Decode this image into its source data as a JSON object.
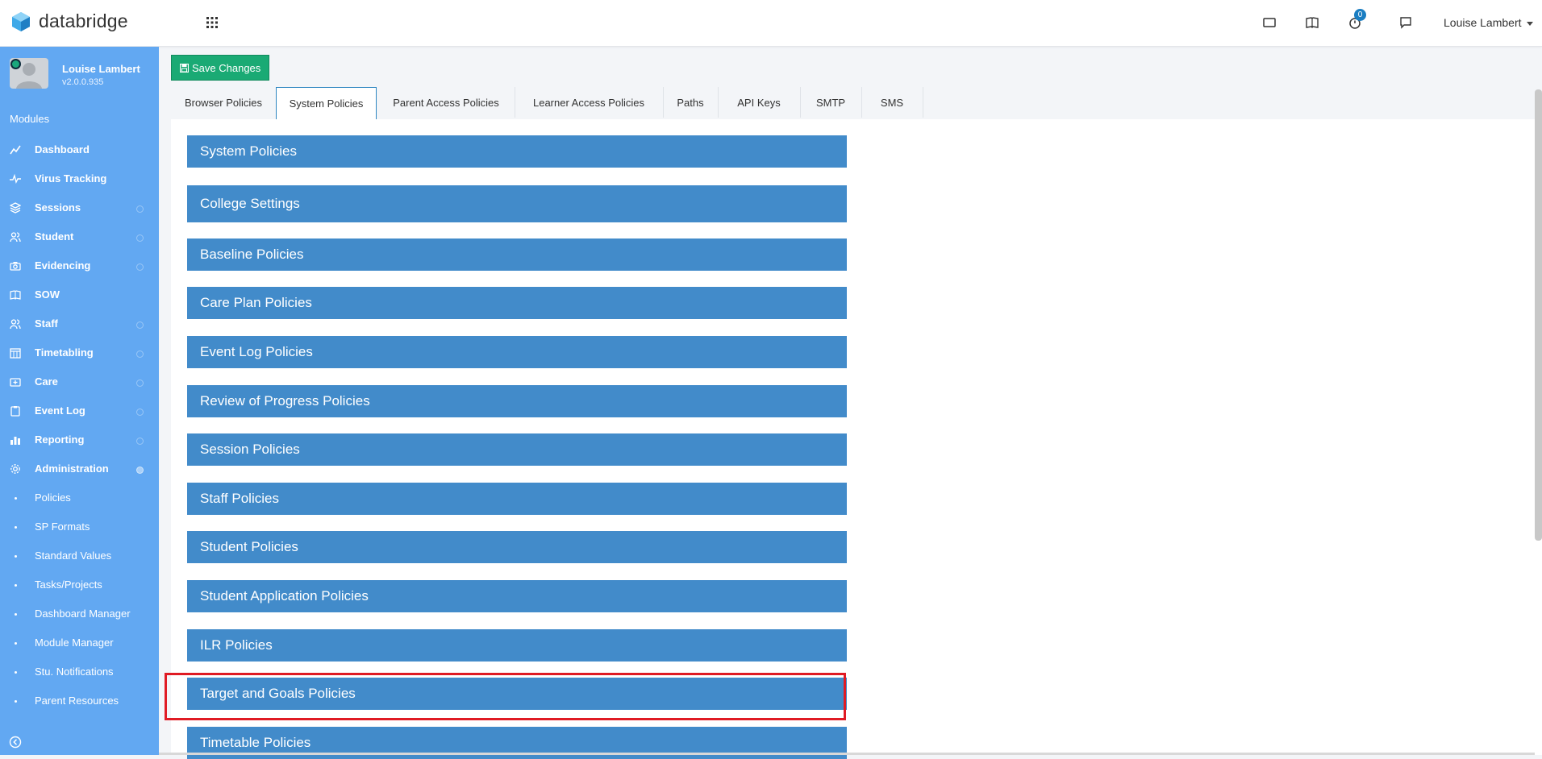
{
  "header": {
    "app_name": "databridge",
    "notification_count": "0",
    "user_name": "Louise Lambert"
  },
  "sidebar": {
    "profile_name": "Louise Lambert",
    "version": "v2.0.0.935",
    "section_label": "Modules",
    "nav_items": [
      {
        "label": "Dashboard"
      },
      {
        "label": "Virus Tracking"
      },
      {
        "label": "Sessions"
      },
      {
        "label": "Student"
      },
      {
        "label": "Evidencing"
      },
      {
        "label": "SOW"
      },
      {
        "label": "Staff"
      },
      {
        "label": "Timetabling"
      },
      {
        "label": "Care"
      },
      {
        "label": "Event Log"
      },
      {
        "label": "Reporting"
      },
      {
        "label": "Administration"
      }
    ],
    "sub_items": [
      {
        "label": "Policies"
      },
      {
        "label": "SP Formats"
      },
      {
        "label": "Standard Values"
      },
      {
        "label": "Tasks/Projects"
      },
      {
        "label": "Dashboard Manager"
      },
      {
        "label": "Module Manager"
      },
      {
        "label": "Stu. Notifications"
      },
      {
        "label": "Parent Resources"
      }
    ]
  },
  "toolbar": {
    "save_label": "Save Changes"
  },
  "tabs": [
    {
      "label": "Browser Policies"
    },
    {
      "label": "System Policies"
    },
    {
      "label": "Parent Access Policies"
    },
    {
      "label": "Learner Access Policies"
    },
    {
      "label": "Paths"
    },
    {
      "label": "API Keys"
    },
    {
      "label": "SMTP"
    },
    {
      "label": "SMS"
    }
  ],
  "active_tab": "System Policies",
  "sections": [
    {
      "label": "System Policies"
    },
    {
      "label": "College Settings"
    },
    {
      "label": "Baseline Policies"
    },
    {
      "label": "Care Plan Policies"
    },
    {
      "label": "Event Log Policies"
    },
    {
      "label": "Review of Progress Policies"
    },
    {
      "label": "Session Policies"
    },
    {
      "label": "Staff Policies"
    },
    {
      "label": "Student Policies"
    },
    {
      "label": "Student Application Policies"
    },
    {
      "label": "ILR Policies"
    },
    {
      "label": "Target and Goals Policies"
    },
    {
      "label": "Timetable Policies"
    }
  ],
  "colors": {
    "sidebar_bg": "#62a8f2",
    "accordion_bg": "#428bca",
    "save_button_bg": "#1aaa74",
    "highlight_border": "#e01b24",
    "badge_bg": "#1b7ec2"
  }
}
